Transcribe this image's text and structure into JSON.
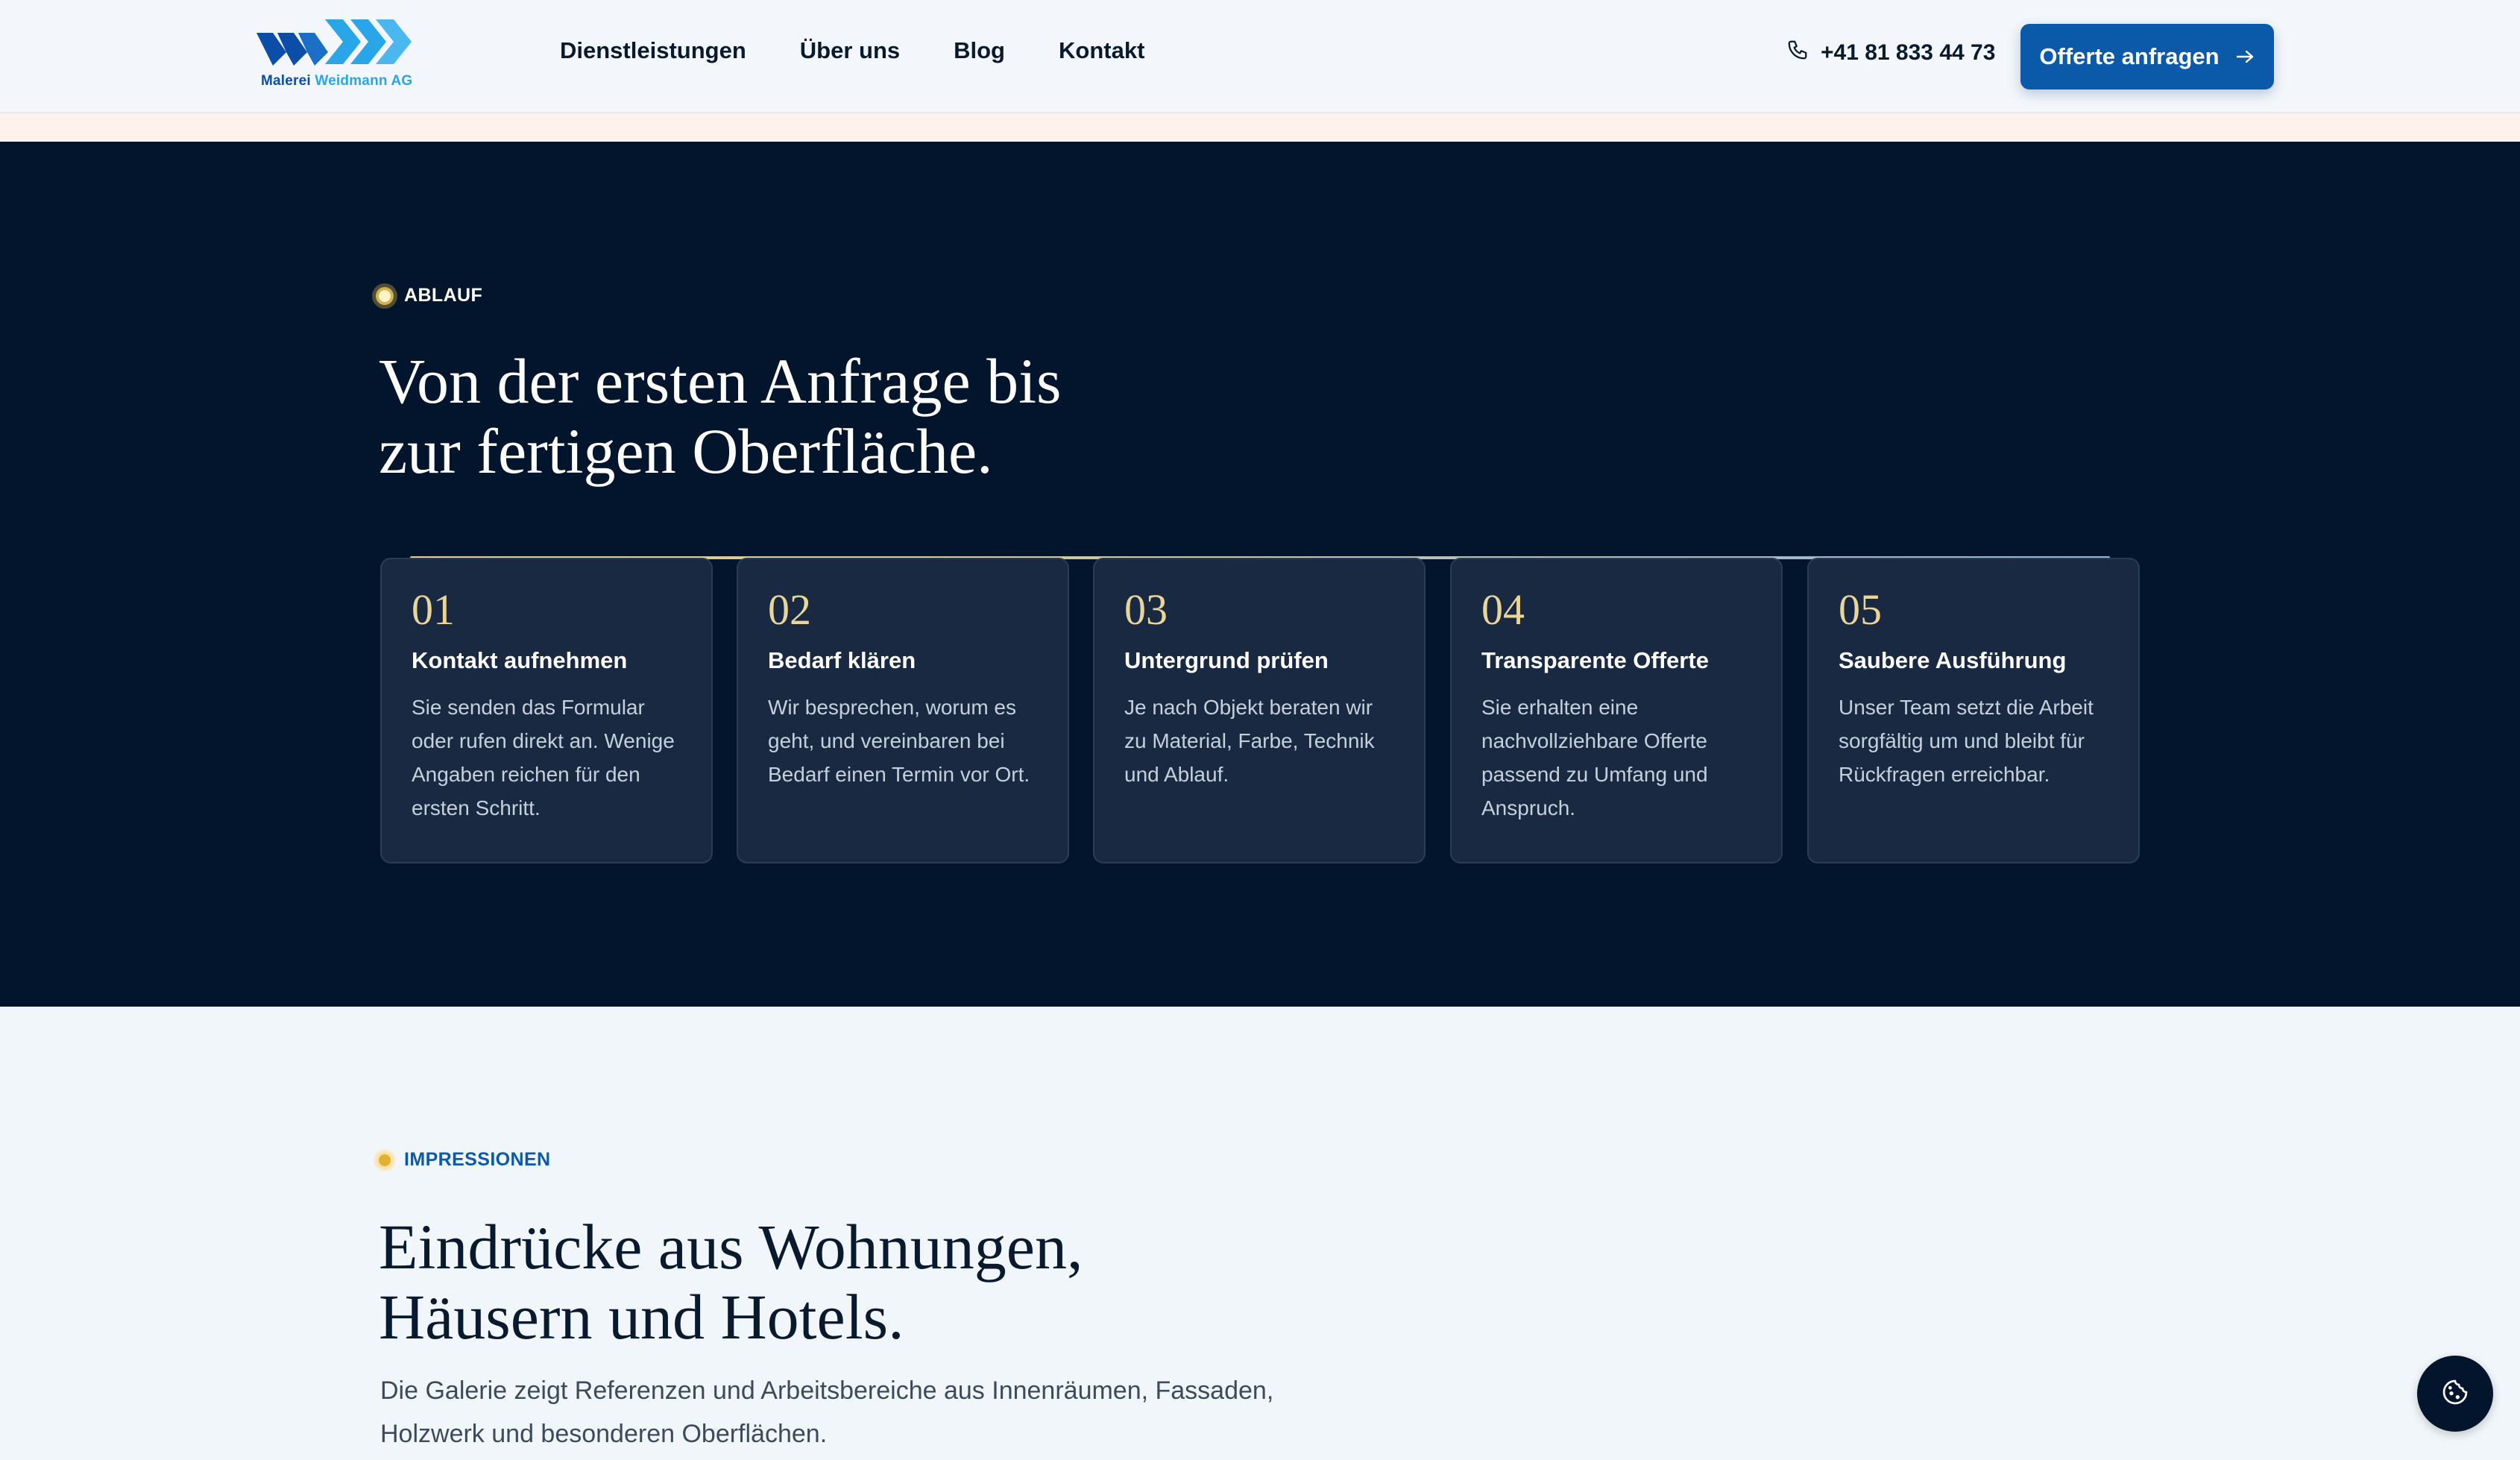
{
  "brand": {
    "logo_text_part1": "Malerei",
    "logo_text_part2": "Weidmann AG",
    "colors": {
      "primary": "#0a5aa9",
      "accent_light": "#29a6e8",
      "dark_bg": "#03142d",
      "gold": "#e9d49a"
    }
  },
  "header": {
    "nav": [
      "Dienstleistungen",
      "Über uns",
      "Blog",
      "Kontakt"
    ],
    "phone": "+41 81 833 44 73",
    "phone_icon": "phone-icon",
    "cta_label": "Offerte anfragen",
    "cta_icon": "arrow-right-icon"
  },
  "process": {
    "eyebrow": "ABLAUF",
    "title_line1": "Von der ersten Anfrage bis",
    "title_line2": "zur fertigen Oberfläche.",
    "steps": [
      {
        "num": "01",
        "title": "Kontakt aufnehmen",
        "text": "Sie senden das Formular oder rufen direkt an. Wenige Angaben reichen für den ersten Schritt."
      },
      {
        "num": "02",
        "title": "Bedarf klären",
        "text": "Wir besprechen, worum es geht, und vereinbaren bei Bedarf einen Termin vor Ort."
      },
      {
        "num": "03",
        "title": "Untergrund prüfen",
        "text": "Je nach Objekt beraten wir zu Material, Farbe, Technik und Ablauf."
      },
      {
        "num": "04",
        "title": "Transparente Offerte",
        "text": "Sie erhalten eine nachvollziehbare Offerte passend zu Umfang und Anspruch."
      },
      {
        "num": "05",
        "title": "Saubere Ausführung",
        "text": "Unser Team setzt die Arbeit sorgfältig um und bleibt für Rückfragen erreichbar."
      }
    ]
  },
  "gallery": {
    "eyebrow": "IMPRESSIONEN",
    "title_line1": "Eindrücke aus Wohnungen,",
    "title_line2": "Häusern und Hotels.",
    "lead": "Die Galerie zeigt Referenzen und Arbeitsbereiche aus Innenräumen, Fassaden, Holzwerk und besonderen Oberflächen."
  },
  "cookie_button_icon": "cookie-icon"
}
